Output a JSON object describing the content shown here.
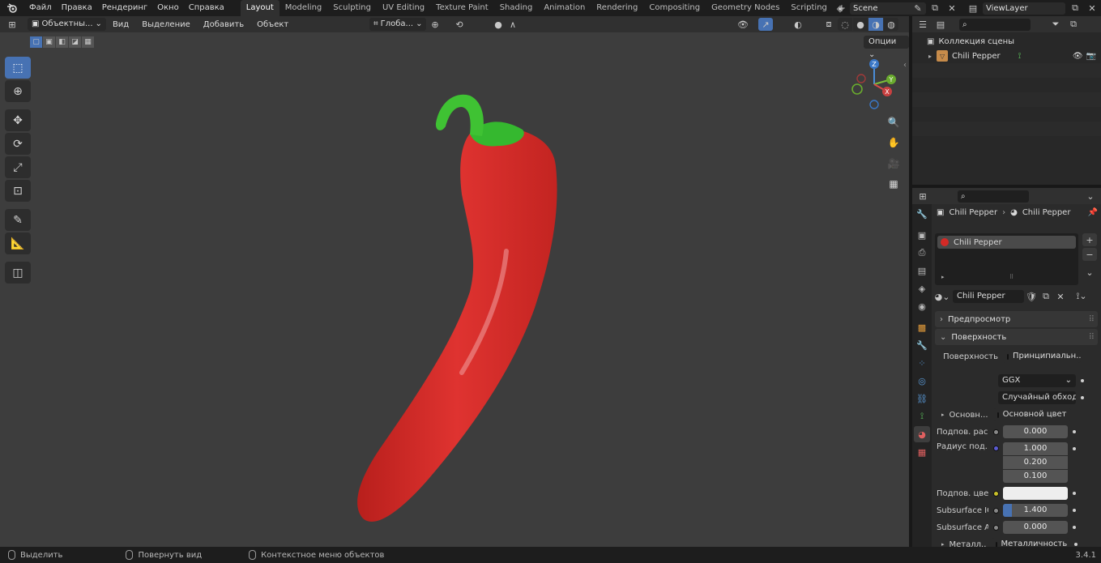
{
  "menubar": {
    "logo": "blender-logo-icon",
    "menus": [
      "Файл",
      "Правка",
      "Рендеринг",
      "Окно",
      "Справка"
    ],
    "workspaces": [
      "Layout",
      "Modeling",
      "Sculpting",
      "UV Editing",
      "Texture Paint",
      "Shading",
      "Animation",
      "Rendering",
      "Compositing",
      "Geometry Nodes",
      "Scripting"
    ],
    "active_workspace": "Layout",
    "add_workspace": "+",
    "scene": "Scene",
    "view_layer": "ViewLayer"
  },
  "viewport": {
    "mode": "Объектны...",
    "menus": [
      "Вид",
      "Выделение",
      "Добавить",
      "Объект"
    ],
    "transform_orientation": "Глоба...",
    "options": "Опции",
    "shading_modes": [
      "wireframe",
      "solid",
      "material",
      "rendered"
    ],
    "active_shading": "material",
    "tools": [
      "select-box-icon",
      "cursor-icon",
      "move-icon",
      "rotate-icon",
      "scale-icon",
      "transform-icon",
      "annotate-icon",
      "measure-icon",
      "add-cube-icon"
    ],
    "active_tool": "select-box-icon",
    "gizmo_axes": {
      "x": "X",
      "y": "Y",
      "z": "Z"
    },
    "nav_buttons": [
      "zoom-icon",
      "hand-pan-icon",
      "camera-view-icon",
      "grid-ortho-icon"
    ],
    "object": "Chili Pepper",
    "colors": {
      "pepper_red": "#d42a26",
      "stem_green": "#2fa82a",
      "background": "#3d3d3d",
      "accent": "#4772b3"
    }
  },
  "outliner": {
    "search_placeholder": "",
    "collection": "Коллекция сцены",
    "items": [
      {
        "name": "Chili Pepper",
        "type": "mesh"
      }
    ]
  },
  "properties": {
    "breadcrumb": [
      "Chili Pepper",
      "Chili Pepper"
    ],
    "material_slots": [
      "Chili Pepper"
    ],
    "material_name": "Chili Pepper",
    "panels": {
      "preview": "Предпросмотр",
      "surface": "Поверхность"
    },
    "surface": {
      "label": "Поверхность",
      "shader": "Принципиальн...",
      "distribution": "GGX",
      "subsurface_method": "Случайный обход",
      "base_label": "Основн...",
      "base_value": "Основной цвет",
      "subsurface_label": "Подпов. рас...",
      "subsurface_value": "0.000",
      "radius_label": "Радиус под...",
      "radius": [
        "1.000",
        "0.200",
        "0.100"
      ],
      "sss_color_label": "Подпов. цвет",
      "sss_color": "#eeeeee",
      "ior_label": "Subsurface IOR",
      "ior_value": "1.400",
      "ior_fraction": 0.14,
      "aniso_label": "Subsurface A...",
      "aniso_value": "0.000",
      "metal_label": "Металл...",
      "metal_value": "Металличность"
    }
  },
  "statusbar": {
    "items": [
      "Выделить",
      "Повернуть вид",
      "Контекстное меню объектов"
    ],
    "version": "3.4.1"
  }
}
